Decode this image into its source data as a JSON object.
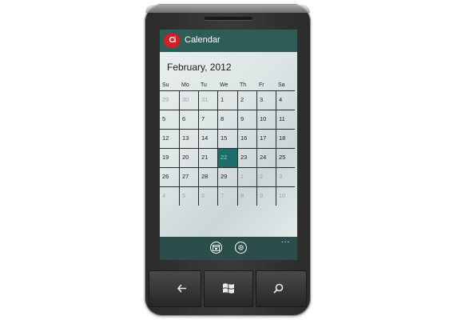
{
  "app": {
    "logo_text": "Ci",
    "title": "Calendar",
    "colors": {
      "titlebar": "#2e5c56",
      "appbar": "#2b4e4a",
      "today": "#1d6e6a",
      "logo": "#d01f26"
    }
  },
  "calendar": {
    "month_label": "February, 2012",
    "weekdays": [
      "Su",
      "Mo",
      "Tu",
      "We",
      "Th",
      "Fr",
      "Sa"
    ],
    "selected_day": "22",
    "weeks": [
      [
        "29",
        "30",
        "31",
        "1",
        "2",
        "3",
        "4"
      ],
      [
        "5",
        "6",
        "7",
        "8",
        "9",
        "10",
        "11"
      ],
      [
        "12",
        "13",
        "14",
        "15",
        "16",
        "17",
        "18"
      ],
      [
        "19",
        "20",
        "21",
        "22",
        "23",
        "24",
        "25"
      ],
      [
        "26",
        "27",
        "28",
        "29",
        "1",
        "2",
        "3"
      ],
      [
        "4",
        "5",
        "6",
        "7",
        "8",
        "9",
        "10"
      ]
    ]
  },
  "appbar": {
    "buttons": [
      "calendar-today-icon",
      "settings-icon"
    ],
    "more": "..."
  },
  "hardware_buttons": [
    "back-arrow-icon",
    "windows-start-icon",
    "search-icon"
  ]
}
